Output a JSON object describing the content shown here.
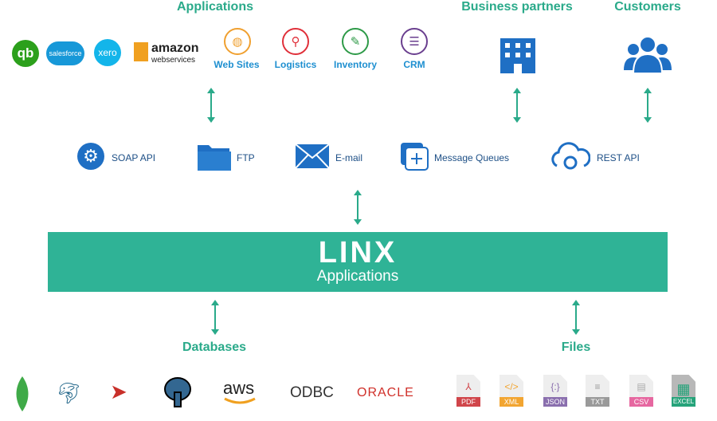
{
  "headings": {
    "applications": "Applications",
    "business_partners": "Business partners",
    "customers": "Customers",
    "databases": "Databases",
    "files": "Files"
  },
  "vendor_logos": {
    "quickbooks": "qb",
    "salesforce": "salesforce",
    "xero": "xero",
    "amazon": "amazon",
    "amazon_sub": "webservices"
  },
  "app_items": [
    {
      "label": "Web Sites",
      "icon": "globe-icon",
      "color": "#f0a030"
    },
    {
      "label": "Logistics",
      "icon": "location-pin-icon",
      "color": "#e0303a"
    },
    {
      "label": "Inventory",
      "icon": "clipboard-edit-icon",
      "color": "#2e9a48"
    },
    {
      "label": "CRM",
      "icon": "document-list-icon",
      "color": "#6a3f8f"
    }
  ],
  "protocols": [
    {
      "label": "SOAP API",
      "icon": "gear-globe-icon"
    },
    {
      "label": "FTP",
      "icon": "folder-icon"
    },
    {
      "label": "E-mail",
      "icon": "envelope-icon"
    },
    {
      "label": "Message Queues",
      "icon": "add-message-icon"
    },
    {
      "label": "REST API",
      "icon": "cloud-sync-icon"
    }
  ],
  "main": {
    "logo": "LINX",
    "subtitle": "Applications",
    "color": "#2fb396"
  },
  "databases": {
    "aws": "aws",
    "odbc": "ODBC",
    "oracle": "ORACLE"
  },
  "files": [
    {
      "label": "PDF",
      "color": "#d0454a",
      "glyph": "⅄"
    },
    {
      "label": "XML",
      "color": "#f2a531",
      "glyph": "</>"
    },
    {
      "label": "JSON",
      "color": "#8a6fae",
      "glyph": "{:}"
    },
    {
      "label": "TXT",
      "color": "#9a9a9a",
      "glyph": "≡"
    },
    {
      "label": "CSV",
      "color": "#e667a0",
      "glyph": "▤"
    },
    {
      "label": "EXCEL",
      "color": "#26a37a",
      "glyph": "▦"
    }
  ]
}
